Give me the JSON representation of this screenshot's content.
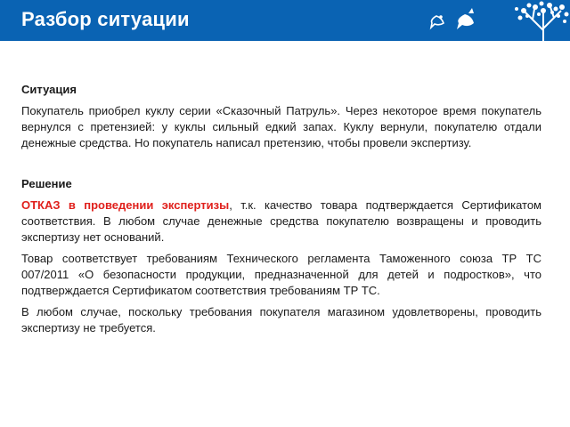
{
  "header": {
    "title": "Разбор ситуации",
    "brand_color": "#0a63b3",
    "decor_icons": [
      "bird-icon",
      "bird-icon",
      "tree-icon"
    ]
  },
  "situation": {
    "heading": "Ситуация",
    "text": "Покупатель приобрел куклу серии «Сказочный Патруль».  Через некоторое время покупатель вернулся с претензией: у куклы сильный едкий запах. Куклу вернули, покупателю отдали денежные средства. Но покупатель написал претензию, чтобы провели экспертизу."
  },
  "solution": {
    "heading": "Решение",
    "refusal_highlight": "ОТКАЗ в проведении экспертизы",
    "refusal_rest": ", т.к. качество товара подтверждается Сертификатом соответствия. В любом случае денежные средства покупателю возвращены и проводить экспертизу нет оснований.",
    "paragraph2": "Товар соответствует требованиям Технического регламента Таможенного союза ТР ТС 007/2011 «О безопасности продукции, предназначенной для детей и подростков», что подтверждается Сертификатом соответствия требованиям ТР ТС.",
    "paragraph3": "В любом случае, поскольку требования покупателя магазином удовлетворены, проводить экспертизу не требуется.",
    "highlight_color": "#e0201c"
  }
}
